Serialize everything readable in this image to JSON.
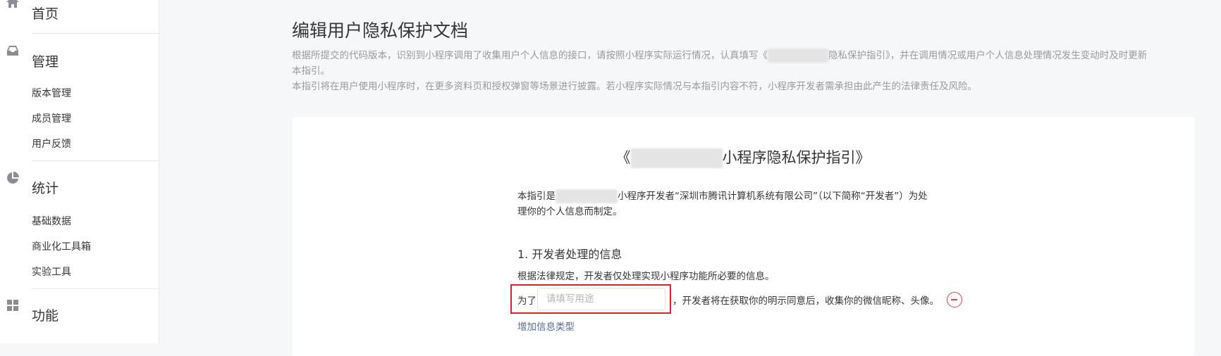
{
  "sidebar": {
    "groups": [
      {
        "label": "首页",
        "icon": "home-icon",
        "items": []
      },
      {
        "label": "管理",
        "icon": "inbox-icon",
        "items": [
          "版本管理",
          "成员管理",
          "用户反馈"
        ]
      },
      {
        "label": "统计",
        "icon": "pie-chart-icon",
        "items": [
          "基础数据",
          "商业化工具箱",
          "实验工具"
        ]
      },
      {
        "label": "功能",
        "icon": "grid-icon",
        "items": []
      }
    ]
  },
  "page": {
    "title": "编辑用户隐私保护文档",
    "desc_line1_a": "根据所提交的代码版本，识别到小程序调用了收集用户个人信息的接口，请按照小程序实际运行情况，认真填写《",
    "desc_line1_b": "隐私保护指引》，并在调用情况或用户个人信息处理情况发生变动时及时更新",
    "desc_line2": "本指引。",
    "desc_line3": "本指引将在用户使用小程序时，在更多资料页和授权弹窗等场景进行披露。若小程序实际情况与本指引内容不符，小程序开发者需承担由此产生的法律责任及风险。"
  },
  "doc": {
    "title_open": "《",
    "title_rest": "小程序隐私保护指引》",
    "intro_a": "本指引是",
    "intro_b": "小程序开发者“深圳市腾讯计算机系统有限公司”（以下简称“开发者”）为处",
    "intro_c": "理你的个人信息而制定。",
    "section1_title": "1. 开发者处理的信息",
    "section1_desc": "根据法律规定，开发者仅处理实现小程序功能所必要的信息。",
    "row_prefix": "为了",
    "purpose_placeholder": "请填写用途",
    "row_suffix": "，开发者将在获取你的明示同意后，收集你的微信昵称、头像。",
    "add_link": "增加信息类型"
  }
}
